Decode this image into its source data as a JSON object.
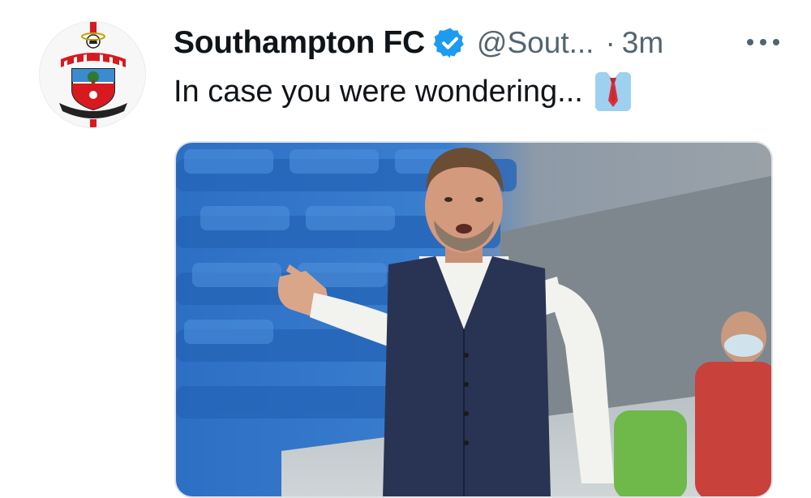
{
  "tweet": {
    "display_name": "Southampton FC",
    "verified_icon": "verified-badge-icon",
    "handle": "@Sout...",
    "separator": "·",
    "timestamp": "3m",
    "more_icon": "more-options-icon",
    "text": "In case you were wondering...",
    "emoji": "necktie-emoji",
    "avatar": "southampton-crest-logo",
    "media": "photo-manager-pointing-in-stadium"
  },
  "colors": {
    "primary_text": "#0f1419",
    "secondary_text": "#536471",
    "verified_blue": "#1d9bf0",
    "crest_red": "#d71920"
  }
}
